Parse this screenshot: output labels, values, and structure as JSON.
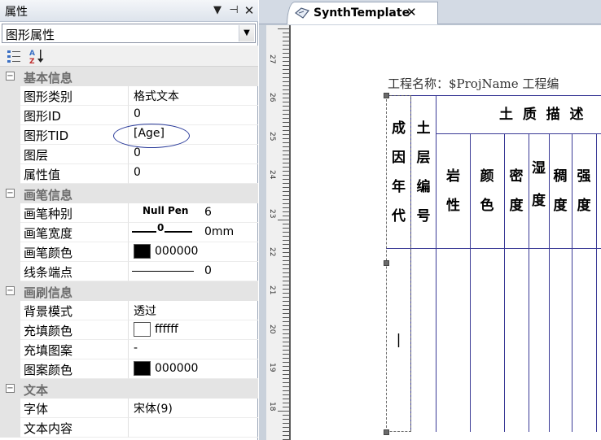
{
  "panel": {
    "title": "属性",
    "title_icons": [
      "dropdown-icon",
      "pin-icon",
      "close-icon"
    ],
    "object_select": {
      "value": "图形属性"
    },
    "categories": [
      {
        "label": "基本信息",
        "rows": [
          {
            "name": "图形类别",
            "value": "格式文本"
          },
          {
            "name": "图形ID",
            "value": "0"
          },
          {
            "name": "图形TID",
            "value": "[Age]"
          },
          {
            "name": "图层",
            "value": "0"
          },
          {
            "name": "属性值",
            "value": "0"
          }
        ]
      },
      {
        "label": "画笔信息",
        "rows": [
          {
            "name": "画笔种别",
            "pen_label": "Null Pen",
            "value": "6"
          },
          {
            "name": "画笔宽度",
            "pen_marker": "0",
            "value": "0mm"
          },
          {
            "name": "画笔颜色",
            "color": "#000000",
            "value": "000000"
          },
          {
            "name": "线条端点",
            "value": "0"
          }
        ]
      },
      {
        "label": "画刷信息",
        "rows": [
          {
            "name": "背景模式",
            "value": "透过"
          },
          {
            "name": "充填颜色",
            "color": "#ffffff",
            "value": "ffffff"
          },
          {
            "name": "充填图案",
            "value": "-"
          },
          {
            "name": "图案颜色",
            "color": "#000000",
            "value": "000000"
          }
        ]
      },
      {
        "label": "文本",
        "rows": [
          {
            "name": "字体",
            "value": "宋体(9)"
          },
          {
            "name": "文本内容",
            "value": ""
          }
        ]
      }
    ]
  },
  "document": {
    "tab": {
      "label": "SynthTemplate",
      "close": "✕"
    },
    "ruler_numbers": [
      "27",
      "26",
      "25",
      "24",
      "23",
      "22",
      "21",
      "20",
      "19",
      "18"
    ],
    "header_line": "工程名称：$ProjName   工程编",
    "table": {
      "col_cheng": [
        "成",
        "因",
        "年",
        "代"
      ],
      "col_tu": [
        "土",
        "层",
        "编",
        "号"
      ],
      "group_header": "土  质  描  述",
      "sub_yan": [
        "岩",
        "性"
      ],
      "sub_yan2": [
        "颜",
        "色"
      ],
      "sub_mi": [
        "密",
        "度"
      ],
      "sub_shi": [
        "湿",
        "度"
      ],
      "sub_chou": [
        "稠",
        "度"
      ],
      "sub_qiang": [
        "强",
        "度"
      ],
      "cursor": "|"
    }
  },
  "colors": {
    "table_line": "#3a3a96",
    "panel_gutter": "#e4e4e4",
    "annotation": "#2a3b9a"
  }
}
